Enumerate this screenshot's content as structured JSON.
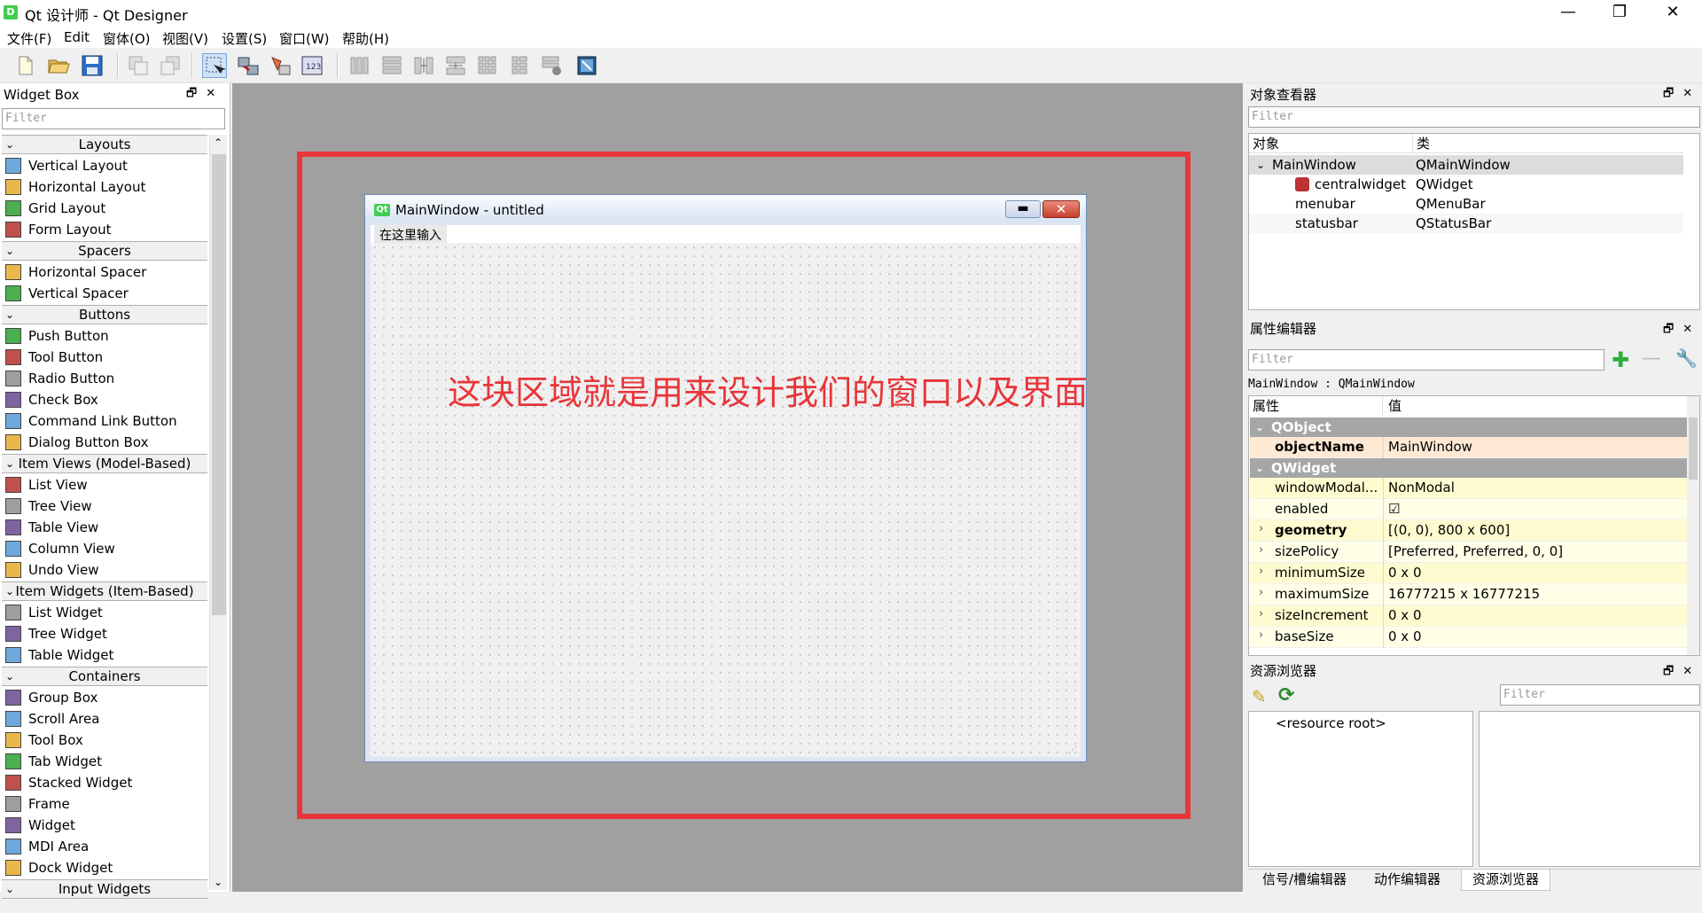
{
  "window": {
    "title": "Qt 设计师 - Qt Designer",
    "icon_letter": "D"
  },
  "menubar": [
    "文件(F)",
    "Edit",
    "窗体(O)",
    "视图(V)",
    "设置(S)",
    "窗口(W)",
    "帮助(H)"
  ],
  "widget_box": {
    "title": "Widget Box",
    "filter_placeholder": "Filter",
    "categories": [
      {
        "label": "Layouts",
        "items": [
          "Vertical Layout",
          "Horizontal Layout",
          "Grid Layout",
          "Form Layout"
        ]
      },
      {
        "label": "Spacers",
        "items": [
          "Horizontal Spacer",
          "Vertical Spacer"
        ]
      },
      {
        "label": "Buttons",
        "items": [
          "Push Button",
          "Tool Button",
          "Radio Button",
          "Check Box",
          "Command Link Button",
          "Dialog Button Box"
        ]
      },
      {
        "label": "Item Views (Model-Based)",
        "items": [
          "List View",
          "Tree View",
          "Table View",
          "Column View",
          "Undo View"
        ]
      },
      {
        "label": "Item Widgets (Item-Based)",
        "items": [
          "List Widget",
          "Tree Widget",
          "Table Widget"
        ]
      },
      {
        "label": "Containers",
        "items": [
          "Group Box",
          "Scroll Area",
          "Tool Box",
          "Tab Widget",
          "Stacked Widget",
          "Frame",
          "Widget",
          "MDI Area",
          "Dock Widget"
        ]
      },
      {
        "label": "Input Widgets",
        "items": []
      }
    ]
  },
  "form": {
    "title": "MainWindow - untitled",
    "menu_placeholder": "在这里输入",
    "annotation": "这块区域就是用来设计我们的窗口以及界面"
  },
  "object_inspector": {
    "title": "对象查看器",
    "filter_placeholder": "Filter",
    "col_object": "对象",
    "col_class": "类",
    "rows": [
      {
        "object": "MainWindow",
        "class": "QMainWindow"
      },
      {
        "object": "centralwidget",
        "class": "QWidget"
      },
      {
        "object": "menubar",
        "class": "QMenuBar"
      },
      {
        "object": "statusbar",
        "class": "QStatusBar"
      }
    ]
  },
  "property_editor": {
    "title": "属性编辑器",
    "filter_placeholder": "Filter",
    "context": "MainWindow : QMainWindow",
    "col_property": "属性",
    "col_value": "值",
    "group_qobject": "QObject",
    "object_name": {
      "name": "objectName",
      "value": "MainWindow"
    },
    "group_qwidget": "QWidget",
    "props": [
      {
        "name": "windowModal...",
        "value": "NonModal"
      },
      {
        "name": "enabled",
        "value": "☑"
      },
      {
        "name": "geometry",
        "value": "[(0, 0), 800 x 600]"
      },
      {
        "name": "sizePolicy",
        "value": "[Preferred, Preferred, 0, 0]"
      },
      {
        "name": "minimumSize",
        "value": "0 x 0"
      },
      {
        "name": "maximumSize",
        "value": "16777215 x 16777215"
      },
      {
        "name": "sizeIncrement",
        "value": "0 x 0"
      },
      {
        "name": "baseSize",
        "value": "0 x 0"
      }
    ]
  },
  "resource_browser": {
    "title": "资源浏览器",
    "filter_placeholder": "Filter",
    "root": "<resource root>",
    "tabs": [
      "信号/槽编辑器",
      "动作编辑器",
      "资源浏览器"
    ]
  }
}
